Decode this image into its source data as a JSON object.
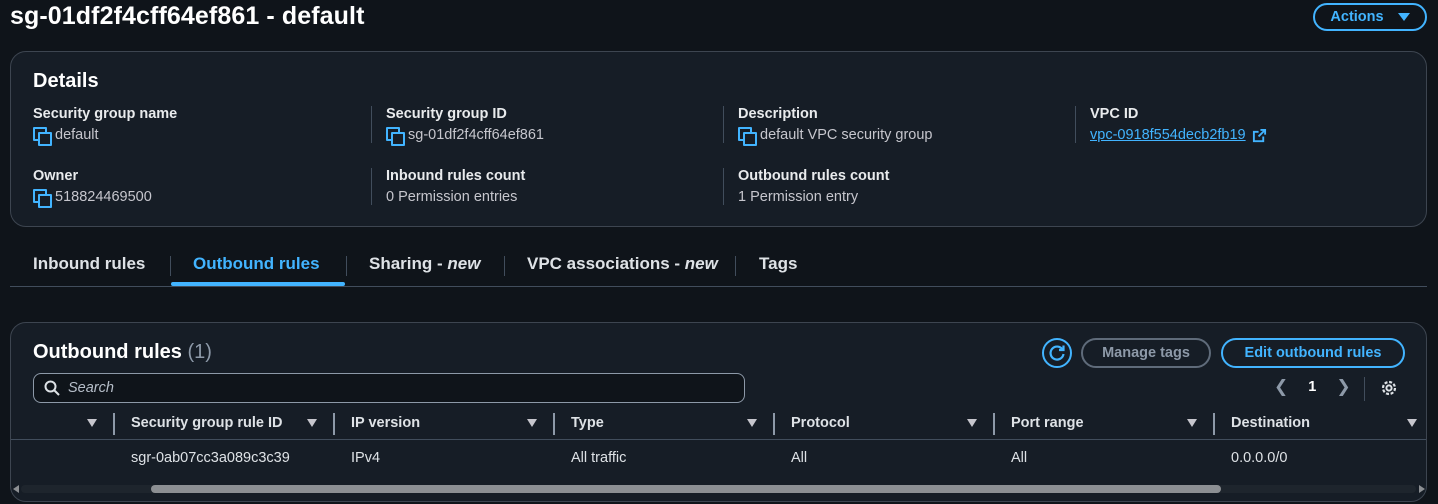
{
  "page": {
    "title": "sg-01df2f4cff64ef861 - default"
  },
  "actions": {
    "label": "Actions"
  },
  "details": {
    "heading": "Details",
    "fields": [
      {
        "label": "Security group name",
        "value": "default"
      },
      {
        "label": "Security group ID",
        "value": "sg-01df2f4cff64ef861"
      },
      {
        "label": "Description",
        "value": "default VPC security group"
      },
      {
        "label": "VPC ID",
        "value": "vpc-0918f554decb2fb19"
      },
      {
        "label": "Owner",
        "value": "518824469500"
      },
      {
        "label": "Inbound rules count",
        "value": "0 Permission entries"
      },
      {
        "label": "Outbound rules count",
        "value": "1 Permission entry"
      }
    ]
  },
  "tabs": [
    {
      "label": "Inbound rules",
      "suffix": ""
    },
    {
      "label": "Outbound rules",
      "suffix": ""
    },
    {
      "label": "Sharing - ",
      "suffix": "new"
    },
    {
      "label": "VPC associations - ",
      "suffix": "new"
    },
    {
      "label": "Tags",
      "suffix": ""
    }
  ],
  "active_tab": "Outbound rules",
  "outbound": {
    "title": "Outbound rules",
    "count": "(1)",
    "manage_tags": "Manage tags",
    "edit_rules": "Edit outbound rules",
    "search_placeholder": "Search",
    "page": "1",
    "columns": [
      "Security group rule ID",
      "IP version",
      "Type",
      "Protocol",
      "Port range",
      "Destination"
    ],
    "rows": [
      {
        "rule_id": "sgr-0ab07cc3a089c3c39",
        "ip_version": "IPv4",
        "type": "All traffic",
        "protocol": "All",
        "port_range": "All",
        "destination": "0.0.0.0/0"
      }
    ]
  },
  "colors": {
    "accent": "#42b4ff",
    "background": "#0f141a",
    "panel": "#161d26"
  },
  "icons": [
    "chevron-down-icon",
    "copy-icon",
    "external-link-icon",
    "refresh-icon",
    "search-icon",
    "chevron-left-icon",
    "chevron-right-icon",
    "gear-icon",
    "sort-caret-icon"
  ]
}
